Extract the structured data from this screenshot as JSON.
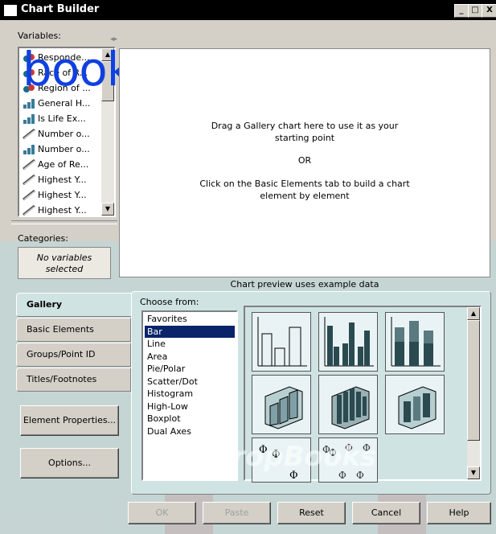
{
  "window": {
    "title": "Chart Builder",
    "controls": [
      "_",
      "□",
      "X"
    ]
  },
  "variables": {
    "label": "Variables:",
    "items": [
      {
        "label": "Responde...",
        "icon": "nominal-icon"
      },
      {
        "label": "Race of R...",
        "icon": "nominal-icon"
      },
      {
        "label": "Region of ...",
        "icon": "nominal-icon"
      },
      {
        "label": "General H...",
        "icon": "ordinal-icon"
      },
      {
        "label": "Is Life Ex...",
        "icon": "ordinal-icon"
      },
      {
        "label": "Number o...",
        "icon": "scale-icon"
      },
      {
        "label": "Number o...",
        "icon": "ordinal-icon"
      },
      {
        "label": "Age of Re...",
        "icon": "scale-icon"
      },
      {
        "label": "Highest Y...",
        "icon": "scale-icon"
      },
      {
        "label": "Highest Y...",
        "icon": "scale-icon"
      },
      {
        "label": "Highest Y...",
        "icon": "scale-icon"
      }
    ]
  },
  "categories": {
    "label": "Categories:",
    "placeholder": "No variables selected"
  },
  "canvas": {
    "line1": "Drag a Gallery chart here to use it as your",
    "line2": "starting point",
    "or": "OR",
    "line3": "Click on the Basic Elements tab to build a chart",
    "line4": "element by element",
    "preview_note": "Chart preview uses example data"
  },
  "tabs": [
    "Gallery",
    "Basic Elements",
    "Groups/Point ID",
    "Titles/Footnotes"
  ],
  "side_buttons": {
    "element_properties": "Element Properties...",
    "options": "Options..."
  },
  "choose_from": {
    "label": "Choose from:",
    "items": [
      "Favorites",
      "Bar",
      "Line",
      "Area",
      "Pie/Polar",
      "Scatter/Dot",
      "Histogram",
      "High-Low",
      "Boxplot",
      "Dual Axes"
    ],
    "selected": "Bar"
  },
  "footer": {
    "ok": "OK",
    "paste": "Paste",
    "reset": "Reset",
    "cancel": "Cancel",
    "help": "Help"
  },
  "watermark": {
    "logo_text": "books",
    "band_text": "DropBooks"
  },
  "colors": {
    "accent": "#0a246a",
    "panel": "#cfe3e3",
    "watermark_band": "#c05050"
  }
}
